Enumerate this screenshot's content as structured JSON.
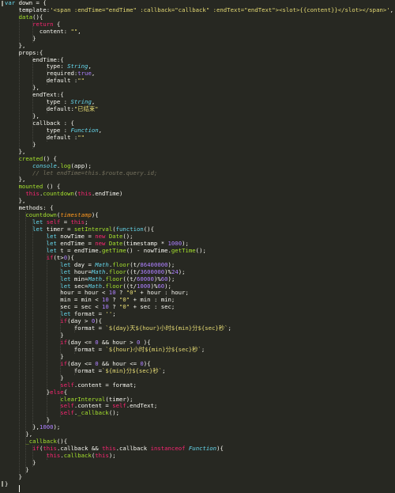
{
  "editor": {
    "background": "#272822",
    "colors": {
      "k": "#66d9ef",
      "kw": "#f92672",
      "s": "#e6db74",
      "n": "#ae81ff",
      "f": "#a6e22e",
      "c": "#75715e",
      "t": "#f8f8f2",
      "p": "#fd971f",
      "v": "#66d9ef"
    },
    "lines": [
      [
        [
          "k",
          "var "
        ],
        [
          "t",
          "down = {"
        ]
      ],
      [
        [
          "t",
          "    template:"
        ],
        [
          "s",
          "'<span :endTime=\"endTime\" :callback=\"callback\" :endText=\"endText\"><slot>{{content}}</slot></span>'"
        ],
        [
          "t",
          ","
        ]
      ],
      [
        [
          "t",
          "    "
        ],
        [
          "f",
          "data"
        ],
        [
          "t",
          "(){"
        ]
      ],
      [
        [
          "t",
          "        "
        ],
        [
          "kw",
          "return"
        ],
        [
          "t",
          " {"
        ]
      ],
      [
        [
          "t",
          "          content: "
        ],
        [
          "s",
          "\"\""
        ],
        [
          "t",
          ","
        ]
      ],
      [
        [
          "t",
          "        }"
        ]
      ],
      [
        [
          "t",
          "    },"
        ]
      ],
      [
        [
          "t",
          "    props:{"
        ]
      ],
      [
        [
          "t",
          "        endTime:{"
        ]
      ],
      [
        [
          "t",
          "            type: "
        ],
        [
          "v",
          "String"
        ],
        [
          "t",
          ","
        ]
      ],
      [
        [
          "t",
          "            required:"
        ],
        [
          "n",
          "true"
        ],
        [
          "t",
          ","
        ]
      ],
      [
        [
          "t",
          "            default :"
        ],
        [
          "s",
          "\"\""
        ]
      ],
      [
        [
          "t",
          "        },"
        ]
      ],
      [
        [
          "t",
          "        endText:{"
        ]
      ],
      [
        [
          "t",
          "            type : "
        ],
        [
          "v",
          "String"
        ],
        [
          "t",
          ","
        ]
      ],
      [
        [
          "t",
          "            default:"
        ],
        [
          "s",
          "\"已结束\""
        ]
      ],
      [
        [
          "t",
          "        },"
        ]
      ],
      [
        [
          "t",
          "        callback : {"
        ]
      ],
      [
        [
          "t",
          "            type : "
        ],
        [
          "v",
          "Function"
        ],
        [
          "t",
          ","
        ]
      ],
      [
        [
          "t",
          "            default :"
        ],
        [
          "s",
          "\"\""
        ]
      ],
      [
        [
          "t",
          "        }"
        ]
      ],
      [
        [
          "t",
          "    },"
        ]
      ],
      [
        [
          "t",
          "    "
        ],
        [
          "f",
          "created"
        ],
        [
          "t",
          "() {"
        ]
      ],
      [
        [
          "t",
          "        "
        ],
        [
          "v",
          "console"
        ],
        [
          "t",
          "."
        ],
        [
          "f",
          "log"
        ],
        [
          "t",
          "(app);"
        ]
      ],
      [
        [
          "t",
          "        "
        ],
        [
          "c",
          "// let endTime=this.$route.query.id;"
        ]
      ],
      [
        [
          "t",
          "    },"
        ]
      ],
      [
        [
          "t",
          "    "
        ],
        [
          "f",
          "mounted"
        ],
        [
          "t",
          " () {"
        ]
      ],
      [
        [
          "t",
          "      "
        ],
        [
          "kw",
          "this"
        ],
        [
          "t",
          "."
        ],
        [
          "f",
          "countdown"
        ],
        [
          "t",
          "("
        ],
        [
          "kw",
          "this"
        ],
        [
          "t",
          ".endTime)"
        ]
      ],
      [
        [
          "t",
          "    },"
        ]
      ],
      [
        [
          "t",
          "    methods: {"
        ]
      ],
      [
        [
          "t",
          "      "
        ],
        [
          "f",
          "countdown"
        ],
        [
          "t",
          "("
        ],
        [
          "p",
          "timestamp"
        ],
        [
          "t",
          "){"
        ]
      ],
      [
        [
          "t",
          "        "
        ],
        [
          "k",
          "let "
        ],
        [
          "kw",
          "self"
        ],
        [
          "t",
          " = "
        ],
        [
          "kw",
          "this"
        ],
        [
          "t",
          ";"
        ]
      ],
      [
        [
          "t",
          "        "
        ],
        [
          "k",
          "let "
        ],
        [
          "t",
          "timer = "
        ],
        [
          "f",
          "setInterval"
        ],
        [
          "t",
          "("
        ],
        [
          "k",
          "function"
        ],
        [
          "t",
          "(){"
        ]
      ],
      [
        [
          "t",
          "            "
        ],
        [
          "k",
          "let "
        ],
        [
          "t",
          "nowTime = "
        ],
        [
          "kw",
          "new "
        ],
        [
          "f",
          "Date"
        ],
        [
          "t",
          "();"
        ]
      ],
      [
        [
          "t",
          "            "
        ],
        [
          "k",
          "let "
        ],
        [
          "t",
          "endTime = "
        ],
        [
          "kw",
          "new "
        ],
        [
          "f",
          "Date"
        ],
        [
          "t",
          "(timestamp * "
        ],
        [
          "n",
          "1000"
        ],
        [
          "t",
          ");"
        ]
      ],
      [
        [
          "t",
          "            "
        ],
        [
          "k",
          "let "
        ],
        [
          "t",
          "t = endTime."
        ],
        [
          "f",
          "getTime"
        ],
        [
          "t",
          "() - nowTime."
        ],
        [
          "f",
          "getTime"
        ],
        [
          "t",
          "();"
        ]
      ],
      [
        [
          "t",
          "            "
        ],
        [
          "kw",
          "if"
        ],
        [
          "t",
          "(t>"
        ],
        [
          "n",
          "0"
        ],
        [
          "t",
          "){"
        ]
      ],
      [
        [
          "t",
          "                "
        ],
        [
          "k",
          "let "
        ],
        [
          "t",
          "day = "
        ],
        [
          "v",
          "Math"
        ],
        [
          "t",
          "."
        ],
        [
          "f",
          "floor"
        ],
        [
          "t",
          "(t/"
        ],
        [
          "n",
          "86400000"
        ],
        [
          "t",
          ");"
        ]
      ],
      [
        [
          "t",
          "                "
        ],
        [
          "k",
          "let "
        ],
        [
          "t",
          "hour="
        ],
        [
          "v",
          "Math"
        ],
        [
          "t",
          "."
        ],
        [
          "f",
          "floor"
        ],
        [
          "t",
          "((t/"
        ],
        [
          "n",
          "3600000"
        ],
        [
          "t",
          ")%"
        ],
        [
          "n",
          "24"
        ],
        [
          "t",
          ");"
        ]
      ],
      [
        [
          "t",
          "                "
        ],
        [
          "k",
          "let "
        ],
        [
          "t",
          "min="
        ],
        [
          "v",
          "Math"
        ],
        [
          "t",
          "."
        ],
        [
          "f",
          "floor"
        ],
        [
          "t",
          "((t/"
        ],
        [
          "n",
          "60000"
        ],
        [
          "t",
          ")%"
        ],
        [
          "n",
          "60"
        ],
        [
          "t",
          ");"
        ]
      ],
      [
        [
          "t",
          "                "
        ],
        [
          "k",
          "let "
        ],
        [
          "t",
          "sec="
        ],
        [
          "v",
          "Math"
        ],
        [
          "t",
          "."
        ],
        [
          "f",
          "floor"
        ],
        [
          "t",
          "((t/"
        ],
        [
          "n",
          "1000"
        ],
        [
          "t",
          ")%"
        ],
        [
          "n",
          "60"
        ],
        [
          "t",
          ");"
        ]
      ],
      [
        [
          "t",
          "                hour = hour < "
        ],
        [
          "n",
          "10"
        ],
        [
          "t",
          " ? "
        ],
        [
          "s",
          "\"0\""
        ],
        [
          "t",
          " + hour : hour;"
        ]
      ],
      [
        [
          "t",
          "                min = min < "
        ],
        [
          "n",
          "10"
        ],
        [
          "t",
          " ? "
        ],
        [
          "s",
          "\"0\""
        ],
        [
          "t",
          " + min : min;"
        ]
      ],
      [
        [
          "t",
          "                sec = sec < "
        ],
        [
          "n",
          "10"
        ],
        [
          "t",
          " ? "
        ],
        [
          "s",
          "\"0\""
        ],
        [
          "t",
          " + sec : sec;"
        ]
      ],
      [
        [
          "t",
          "                "
        ],
        [
          "k",
          "let "
        ],
        [
          "t",
          "format = "
        ],
        [
          "s",
          "''"
        ],
        [
          "t",
          ";"
        ]
      ],
      [
        [
          "t",
          "                "
        ],
        [
          "kw",
          "if"
        ],
        [
          "t",
          "(day > "
        ],
        [
          "n",
          "0"
        ],
        [
          "t",
          "){"
        ]
      ],
      [
        [
          "t",
          "                    format = "
        ],
        [
          "s",
          "`${day}天${hour}小时${min}分${sec}秒`"
        ],
        [
          "t",
          ";"
        ]
      ],
      [
        [
          "t",
          "                }"
        ]
      ],
      [
        [
          "t",
          "                "
        ],
        [
          "kw",
          "if"
        ],
        [
          "t",
          "(day <= "
        ],
        [
          "n",
          "0"
        ],
        [
          "t",
          " && hour > "
        ],
        [
          "n",
          "0"
        ],
        [
          "t",
          " ){"
        ]
      ],
      [
        [
          "t",
          "                    format = "
        ],
        [
          "s",
          "`${hour}小时${min}分${sec}秒`"
        ],
        [
          "t",
          ";"
        ]
      ],
      [
        [
          "t",
          "                }"
        ]
      ],
      [
        [
          "t",
          "                "
        ],
        [
          "kw",
          "if"
        ],
        [
          "t",
          "(day <= "
        ],
        [
          "n",
          "0"
        ],
        [
          "t",
          " && hour <= "
        ],
        [
          "n",
          "0"
        ],
        [
          "t",
          "){"
        ]
      ],
      [
        [
          "t",
          "                    format ="
        ],
        [
          "s",
          "`${min}分${sec}秒`"
        ],
        [
          "t",
          ";"
        ]
      ],
      [
        [
          "t",
          "                }"
        ]
      ],
      [
        [
          "t",
          "                "
        ],
        [
          "kw",
          "self"
        ],
        [
          "t",
          ".content = format;"
        ]
      ],
      [
        [
          "t",
          "            }"
        ],
        [
          "kw",
          "else"
        ],
        [
          "t",
          "{"
        ]
      ],
      [
        [
          "t",
          "                "
        ],
        [
          "f",
          "clearInterval"
        ],
        [
          "t",
          "(timer);"
        ]
      ],
      [
        [
          "t",
          "                "
        ],
        [
          "kw",
          "self"
        ],
        [
          "t",
          ".content = "
        ],
        [
          "kw",
          "self"
        ],
        [
          "t",
          ".endText;"
        ]
      ],
      [
        [
          "t",
          "                "
        ],
        [
          "kw",
          "self"
        ],
        [
          "t",
          "."
        ],
        [
          "f",
          "_callback"
        ],
        [
          "t",
          "();"
        ]
      ],
      [
        [
          "t",
          "            }"
        ]
      ],
      [
        [
          "t",
          "        },"
        ],
        [
          "n",
          "1000"
        ],
        [
          "t",
          ");"
        ]
      ],
      [
        [
          "t",
          "      },"
        ]
      ],
      [
        [
          "t",
          "      "
        ],
        [
          "f",
          "_callback"
        ],
        [
          "t",
          "(){"
        ]
      ],
      [
        [
          "t",
          "        "
        ],
        [
          "kw",
          "if"
        ],
        [
          "t",
          "("
        ],
        [
          "kw",
          "this"
        ],
        [
          "t",
          ".callback && "
        ],
        [
          "kw",
          "this"
        ],
        [
          "t",
          ".callback "
        ],
        [
          "kw",
          "instanceof "
        ],
        [
          "v",
          "Function"
        ],
        [
          "t",
          "){"
        ]
      ],
      [
        [
          "t",
          "            "
        ],
        [
          "kw",
          "this"
        ],
        [
          "t",
          "."
        ],
        [
          "f",
          "callback"
        ],
        [
          "t",
          "("
        ],
        [
          "kw",
          "this"
        ],
        [
          "t",
          ");"
        ]
      ],
      [
        [
          "t",
          "        }"
        ]
      ],
      [
        [
          "t",
          "      }"
        ]
      ],
      [
        [
          "t",
          "    }"
        ]
      ],
      [
        [
          "t",
          "}"
        ]
      ]
    ]
  }
}
